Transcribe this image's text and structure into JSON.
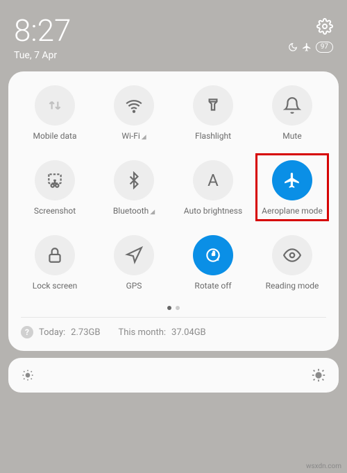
{
  "status": {
    "time": "8:27",
    "date": "Tue, 7 Apr",
    "battery": "97"
  },
  "tiles": [
    {
      "label": "Mobile data"
    },
    {
      "label": "Wi-Fi"
    },
    {
      "label": "Flashlight"
    },
    {
      "label": "Mute"
    },
    {
      "label": "Screenshot"
    },
    {
      "label": "Bluetooth"
    },
    {
      "label": "Auto brightness"
    },
    {
      "label": "Aeroplane mode"
    },
    {
      "label": "Lock screen"
    },
    {
      "label": "GPS"
    },
    {
      "label": "Rotate off"
    },
    {
      "label": "Reading mode"
    }
  ],
  "usage": {
    "today_label": "Today:",
    "today_value": "2.73GB",
    "month_label": "This month:",
    "month_value": "37.04GB"
  },
  "watermark": "wsxdn.com"
}
